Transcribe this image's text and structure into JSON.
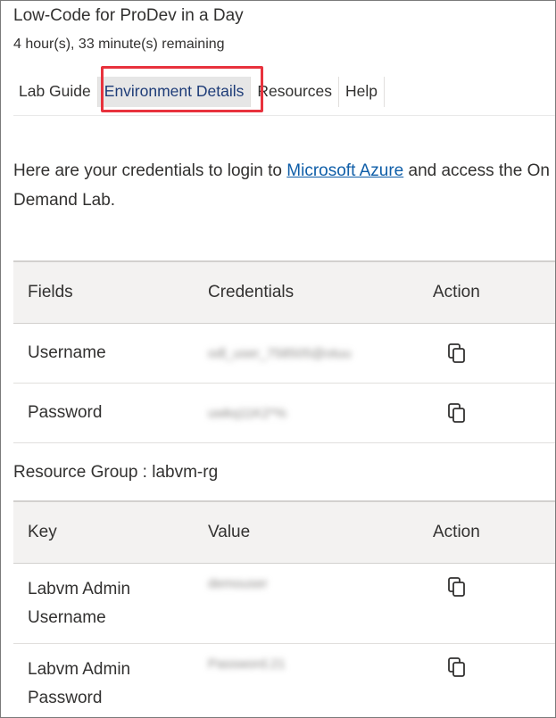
{
  "header": {
    "lab_title": "Low-Code for ProDev in a Day",
    "time_remaining": "4 hour(s), 33 minute(s) remaining"
  },
  "tabs": [
    {
      "label": "Lab Guide",
      "active": false
    },
    {
      "label": "Environment Details",
      "active": true
    },
    {
      "label": "Resources",
      "active": false
    },
    {
      "label": "Help",
      "active": false
    }
  ],
  "intro": {
    "text_before": "Here are your credentials to login to ",
    "link_text": "Microsoft Azure",
    "text_after": " and access the On Demand Lab."
  },
  "credentials_table": {
    "headers": [
      "Fields",
      "Credentials",
      "Action"
    ],
    "rows": [
      {
        "field": "Username",
        "value": "odl_user_758505@otuu",
        "action_icon": "copy-icon"
      },
      {
        "field": "Password",
        "value": "uwkq11K2*%",
        "action_icon": "copy-icon"
      }
    ]
  },
  "resource_group": {
    "label": "Resource Group : labvm-rg"
  },
  "resource_table": {
    "headers": [
      "Key",
      "Value",
      "Action"
    ],
    "rows": [
      {
        "key_line1": "Labvm Admin",
        "key_line2": "Username",
        "value": "demouser",
        "action_icon": "copy-icon"
      },
      {
        "key_line1": "Labvm Admin",
        "key_line2": "Password",
        "value": "Password.21",
        "action_icon": "copy-icon"
      }
    ]
  },
  "colors": {
    "accent_highlight": "#e8323d",
    "link": "#0f5ea8",
    "active_tab_text": "#1e3c78"
  }
}
